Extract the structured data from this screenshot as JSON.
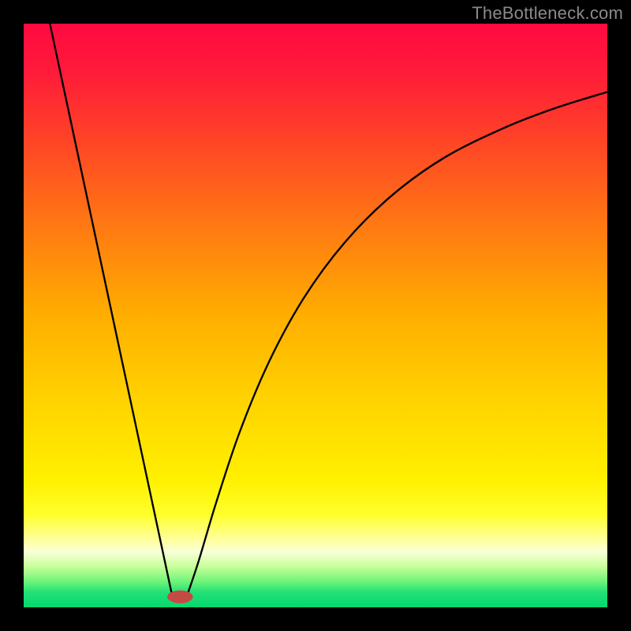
{
  "watermark": "TheBottleneck.com",
  "chart_data": {
    "type": "line",
    "title": "",
    "xlabel": "",
    "ylabel": "",
    "xlim": [
      0,
      100
    ],
    "ylim": [
      0,
      100
    ],
    "background_gradient": {
      "stops": [
        {
          "offset": 0.0,
          "color": "#ff0a40"
        },
        {
          "offset": 0.08,
          "color": "#ff1a3a"
        },
        {
          "offset": 0.2,
          "color": "#ff4426"
        },
        {
          "offset": 0.35,
          "color": "#ff7a12"
        },
        {
          "offset": 0.5,
          "color": "#ffae00"
        },
        {
          "offset": 0.65,
          "color": "#ffd400"
        },
        {
          "offset": 0.78,
          "color": "#fff000"
        },
        {
          "offset": 0.84,
          "color": "#ffff2a"
        },
        {
          "offset": 0.885,
          "color": "#ffffa0"
        },
        {
          "offset": 0.905,
          "color": "#f9ffd8"
        },
        {
          "offset": 0.93,
          "color": "#c8ff9a"
        },
        {
          "offset": 0.955,
          "color": "#70f57a"
        },
        {
          "offset": 0.975,
          "color": "#20e076"
        },
        {
          "offset": 1.0,
          "color": "#05d86f"
        }
      ]
    },
    "series": [
      {
        "name": "left-limb",
        "type": "line",
        "x": [
          4.5,
          25.4
        ],
        "y": [
          100,
          2.2
        ]
      },
      {
        "name": "right-limb",
        "type": "curve",
        "x": [
          28.2,
          30,
          33,
          37,
          42,
          48,
          55,
          63,
          72,
          82,
          91,
          100
        ],
        "y": [
          2.6,
          8,
          18,
          30,
          42,
          53,
          62.5,
          70.5,
          77,
          82,
          85.5,
          88.3
        ]
      }
    ],
    "marker": {
      "name": "bottleneck-marker",
      "cx": 26.8,
      "cy": 1.8,
      "rx": 2.2,
      "ry": 1.1,
      "fill": "#c44a43"
    }
  }
}
